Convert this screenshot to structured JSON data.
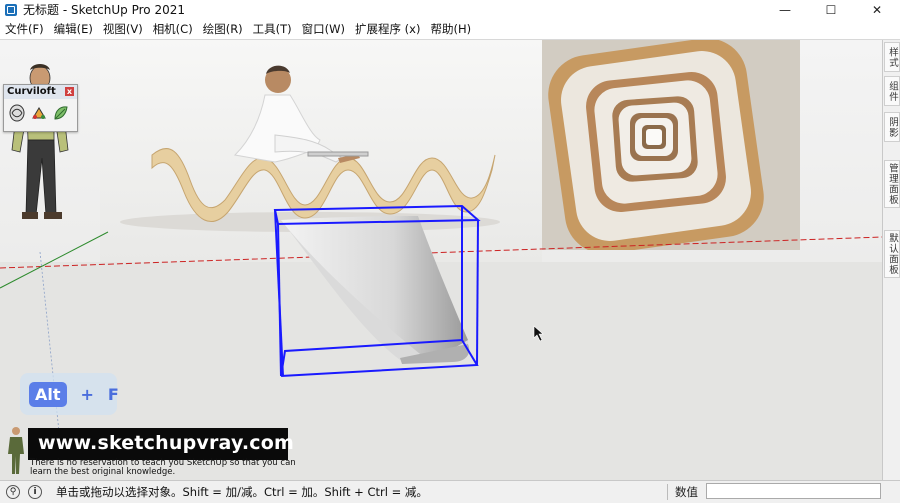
{
  "window": {
    "title": "无标题 - SketchUp Pro 2021",
    "minimize": "—",
    "maximize": "☐",
    "close": "✕"
  },
  "menu": [
    "文件(F)",
    "编辑(E)",
    "视图(V)",
    "相机(C)",
    "绘图(R)",
    "工具(T)",
    "窗口(W)",
    "扩展程序 (x)",
    "帮助(H)"
  ],
  "tray_tabs": [
    "样式",
    "组件",
    "阴影",
    "管理面板",
    "默认面板"
  ],
  "curviloft": {
    "title": "Curviloft",
    "tools": [
      "loft-by-spline-icon",
      "skin-contours-icon",
      "loft-along-path-icon"
    ]
  },
  "key_hint": {
    "key1": "Alt",
    "plus": "+",
    "key2": "F"
  },
  "watermark": {
    "url": "www.sketchupvray.com",
    "tagline": "There is no reservation to teach you SketchUp so that you can learn the best original knowledge."
  },
  "status": {
    "message": "单击或拖动以选择对象。Shift = 加/减。Ctrl = 加。Shift + Ctrl = 减。",
    "measure_label": "数值",
    "measure_value": ""
  },
  "colors": {
    "selection": "#1a1aff",
    "red_axis": "#cc2222",
    "green_axis": "#2e8b2e",
    "title_icon": "#1b6fb8"
  }
}
